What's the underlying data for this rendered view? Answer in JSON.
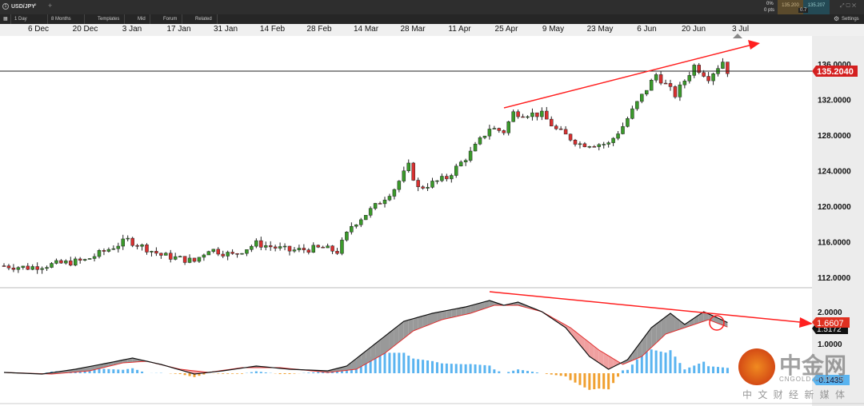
{
  "header": {
    "symbol": "USD/JPY",
    "tab_index": "1",
    "change_pct": "0%",
    "change_pts": "0 pts",
    "bid": "135.200",
    "ask": "135.207",
    "spread": "0.7"
  },
  "toolbar": {
    "interval": "1 Day",
    "range": "8 Months",
    "templates": "Templates",
    "mid": "Mid",
    "forum": "Forum",
    "related": "Related",
    "settings": "Settings"
  },
  "watermark": {
    "name": "中金网",
    "domain": "CNGOLD.COM.CN",
    "tagline": "中 文 财 经 新 媒 体"
  },
  "colors": {
    "up": "#3a9a2a",
    "down": "#d93030",
    "trend": "#ff2020",
    "hist_pos": "#5ab4f0",
    "hist_neg": "#f0a030"
  },
  "chart_data": [
    {
      "type": "candlestick",
      "title": "USD/JPY 1 Day",
      "x_tick_labels": [
        "6 Dec",
        "20 Dec",
        "3 Jan",
        "17 Jan",
        "31 Jan",
        "14 Feb",
        "28 Feb",
        "14 Mar",
        "28 Mar",
        "11 Apr",
        "25 Apr",
        "9 May",
        "23 May",
        "6 Jun",
        "20 Jun",
        "3 Jul"
      ],
      "y_tick_labels": [
        "136.0000",
        "132.0000",
        "128.0000",
        "124.0000",
        "120.0000",
        "116.0000",
        "112.0000"
      ],
      "ylim": [
        111.5,
        141
      ],
      "last_price": "135.2040",
      "close_keyframes": [
        [
          0,
          113.3
        ],
        [
          5,
          113.1
        ],
        [
          17,
          113.9
        ],
        [
          26,
          116.2
        ],
        [
          33,
          114.5
        ],
        [
          40,
          113.8
        ],
        [
          43,
          115.2
        ],
        [
          48,
          114.5
        ],
        [
          53,
          115.8
        ],
        [
          60,
          115
        ],
        [
          67,
          115.3
        ],
        [
          70,
          114.9
        ],
        [
          73,
          117.8
        ],
        [
          78,
          120
        ],
        [
          82,
          122
        ],
        [
          85,
          124.5
        ],
        [
          87,
          122
        ],
        [
          93,
          123.2
        ],
        [
          98,
          126
        ],
        [
          102,
          128.8
        ],
        [
          105,
          128.4
        ],
        [
          107,
          130.5
        ],
        [
          113,
          130.3
        ],
        [
          116,
          128.6
        ],
        [
          121,
          127
        ],
        [
          127,
          127
        ],
        [
          130,
          129
        ],
        [
          133,
          131.6
        ],
        [
          137,
          134.8
        ],
        [
          141,
          132.5
        ],
        [
          145,
          135.8
        ],
        [
          148,
          134.5
        ],
        [
          151,
          136.3
        ],
        [
          152,
          135.2
        ]
      ]
    },
    {
      "type": "line",
      "title": "MACD",
      "y_tick_labels": [
        "2.0000",
        "1.0000"
      ],
      "ylim": [
        -1,
        2.4
      ],
      "macd_value": "1.6607",
      "signal_value": "1.5172",
      "histogram_value": "-0.1435",
      "macd_keyframes": [
        [
          0,
          0.1
        ],
        [
          8,
          0.05
        ],
        [
          15,
          0.2
        ],
        [
          22,
          0.4
        ],
        [
          27,
          0.55
        ],
        [
          33,
          0.35
        ],
        [
          40,
          0.05
        ],
        [
          46,
          0.15
        ],
        [
          53,
          0.3
        ],
        [
          60,
          0.2
        ],
        [
          68,
          0.15
        ],
        [
          72,
          0.3
        ],
        [
          78,
          1.0
        ],
        [
          84,
          1.7
        ],
        [
          90,
          1.95
        ],
        [
          97,
          2.15
        ],
        [
          102,
          2.35
        ],
        [
          105,
          2.2
        ],
        [
          108,
          2.3
        ],
        [
          113,
          2.0
        ],
        [
          118,
          1.5
        ],
        [
          123,
          0.6
        ],
        [
          127,
          0.2
        ],
        [
          131,
          0.5
        ],
        [
          136,
          1.5
        ],
        [
          140,
          1.95
        ],
        [
          143,
          1.6
        ],
        [
          147,
          2.0
        ],
        [
          150,
          1.8
        ],
        [
          152,
          1.66
        ]
      ],
      "signal_keyframes": [
        [
          0,
          0.1
        ],
        [
          10,
          0.05
        ],
        [
          18,
          0.15
        ],
        [
          25,
          0.4
        ],
        [
          30,
          0.45
        ],
        [
          37,
          0.2
        ],
        [
          43,
          0.1
        ],
        [
          50,
          0.25
        ],
        [
          58,
          0.25
        ],
        [
          68,
          0.1
        ],
        [
          74,
          0.2
        ],
        [
          80,
          0.7
        ],
        [
          86,
          1.4
        ],
        [
          92,
          1.75
        ],
        [
          98,
          1.95
        ],
        [
          103,
          2.2
        ],
        [
          108,
          2.2
        ],
        [
          113,
          2.0
        ],
        [
          119,
          1.5
        ],
        [
          125,
          0.8
        ],
        [
          130,
          0.35
        ],
        [
          134,
          0.6
        ],
        [
          139,
          1.3
        ],
        [
          144,
          1.55
        ],
        [
          148,
          1.75
        ],
        [
          152,
          1.52
        ]
      ]
    }
  ]
}
